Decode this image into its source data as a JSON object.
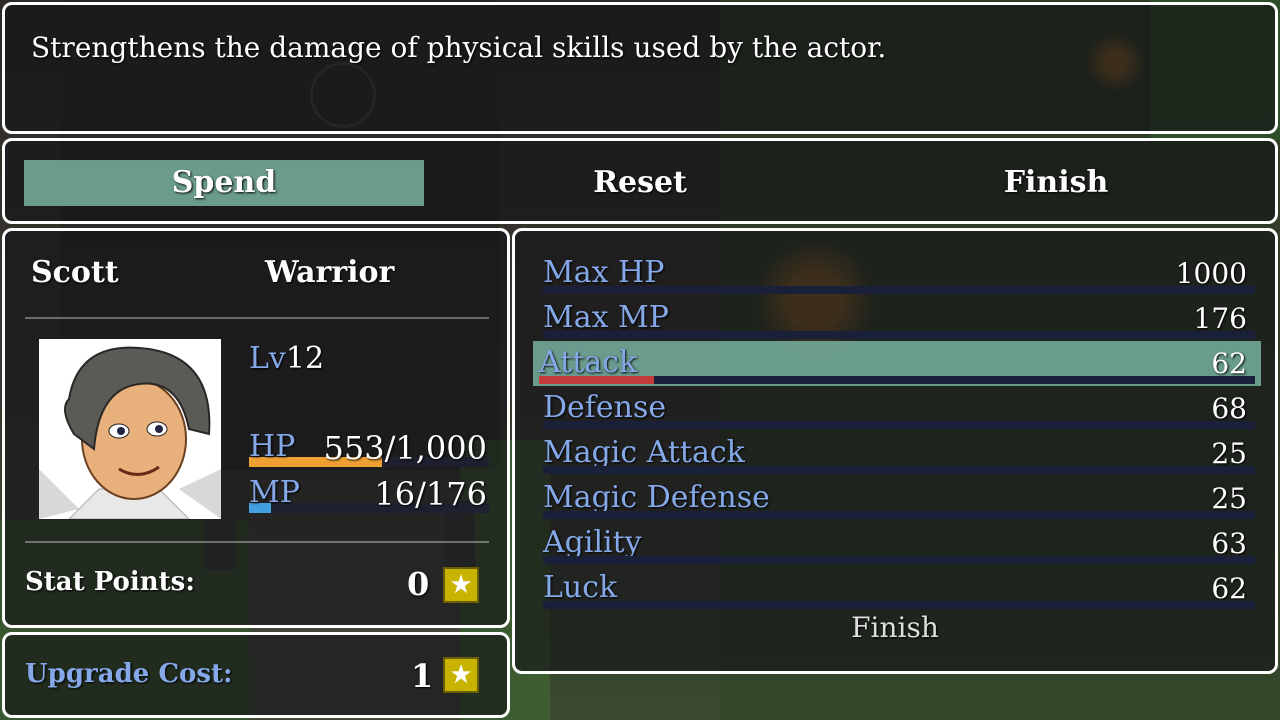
{
  "help": {
    "text": "Strengthens the damage of physical skills used by the actor."
  },
  "commands": [
    {
      "label": "Spend",
      "active": true
    },
    {
      "label": "Reset",
      "active": false
    },
    {
      "label": "Finish",
      "active": false
    }
  ],
  "actor": {
    "name": "Scott",
    "class": "Warrior",
    "level_label": "Lv",
    "level": "12",
    "hp_label": "HP",
    "hp_text": "553/1,000",
    "hp_ratio": 0.553,
    "mp_label": "MP",
    "mp_text": "16/176",
    "mp_ratio": 0.09,
    "stat_points_label": "Stat Points:",
    "stat_points": "0"
  },
  "cost": {
    "label": "Upgrade Cost:",
    "value": "1"
  },
  "params": [
    {
      "name": "Max HP",
      "value": "1000",
      "selected": false
    },
    {
      "name": "Max MP",
      "value": "176",
      "selected": false
    },
    {
      "name": "Attack",
      "value": "62",
      "selected": true,
      "bar_fill": 0.16
    },
    {
      "name": "Defense",
      "value": "68",
      "selected": false
    },
    {
      "name": "Magic Attack",
      "value": "25",
      "selected": false
    },
    {
      "name": "Magic Defense",
      "value": "25",
      "selected": false
    },
    {
      "name": "Agility",
      "value": "63",
      "selected": false
    },
    {
      "name": "Luck",
      "value": "62",
      "selected": false
    }
  ],
  "params_finish_label": "Finish",
  "colors": {
    "selection": "#78b2a0",
    "system_text": "#84a8e8",
    "hp_gauge": "#f0a030",
    "mp_gauge": "#40a0e0",
    "star": "#c8b400"
  },
  "icons": {
    "stat_points": "star-icon",
    "upgrade_cost": "star-icon"
  }
}
